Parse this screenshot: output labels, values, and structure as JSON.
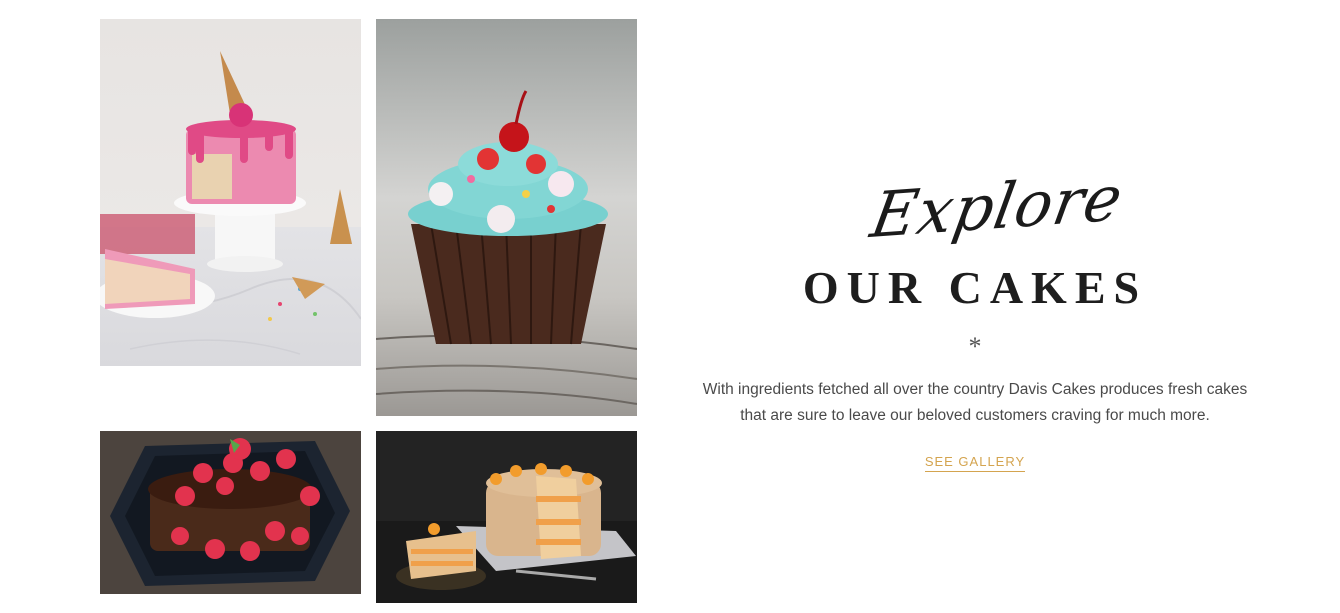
{
  "gallery": {
    "tiles": [
      {
        "id": "funfetti-drip-cake"
      },
      {
        "id": "cherry-cupcake"
      },
      {
        "id": "raspberry-chocolate-cake"
      },
      {
        "id": "orange-layer-cake"
      }
    ]
  },
  "hero": {
    "script_title": "Explore",
    "main_title": "OUR CAKES",
    "divider_symbol": "*",
    "description": "With ingredients fetched all over the country Davis Cakes produces fresh cakes that are sure to leave our beloved customers craving for much more.",
    "cta_label": "SEE GALLERY"
  },
  "colors": {
    "accent": "#d4a44f",
    "heading": "#1e1e1e",
    "body_text": "#4a4a4a",
    "background": "#ffffff"
  }
}
